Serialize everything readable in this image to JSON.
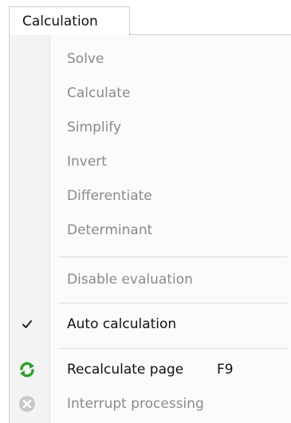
{
  "menu": {
    "title": "Calculation"
  },
  "items": [
    {
      "label": "Solve"
    },
    {
      "label": "Calculate"
    },
    {
      "label": "Simplify"
    },
    {
      "label": "Invert"
    },
    {
      "label": "Differentiate"
    },
    {
      "label": "Determinant"
    },
    {
      "label": "Disable evaluation"
    },
    {
      "label": "Auto calculation",
      "checked": true
    },
    {
      "label": "Recalculate page",
      "shortcut": "F9"
    },
    {
      "label": "Interrupt processing"
    }
  ],
  "icons": {
    "check": "check-icon",
    "recalculate": "refresh-icon",
    "interrupt": "stop-icon"
  },
  "colors": {
    "enabled_text": "#111111",
    "disabled_text": "#8a8a8a",
    "refresh_green": "#2e9e32",
    "stop_gray": "#c8c8c8"
  }
}
